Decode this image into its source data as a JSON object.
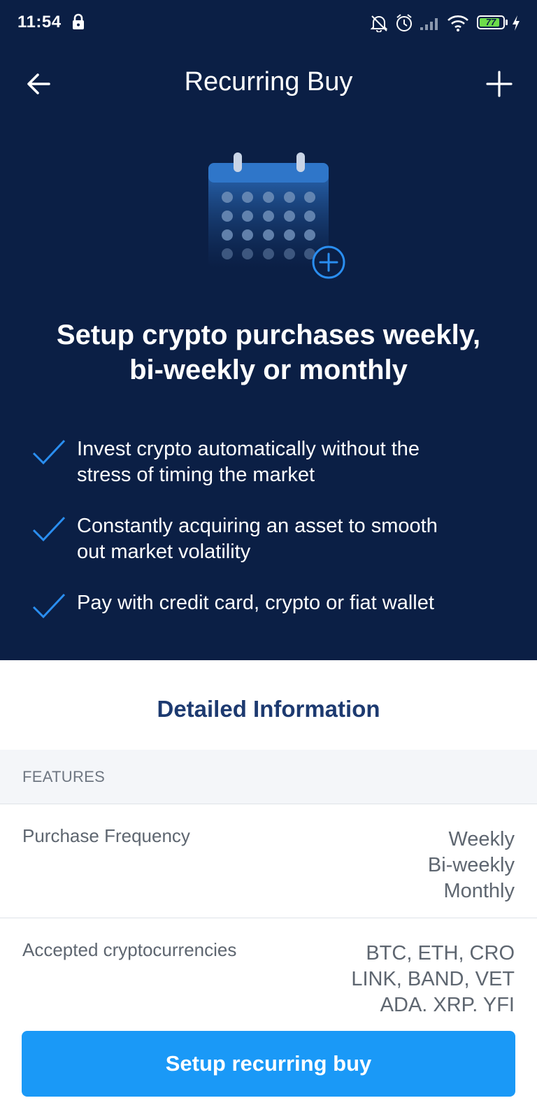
{
  "status_bar": {
    "time": "11:54",
    "battery_level": "77",
    "battery_fraction": 0.77,
    "icons": [
      "lock-icon",
      "mute-icon",
      "alarm-icon",
      "signal-icon",
      "wifi-icon",
      "battery-icon",
      "charging-icon"
    ]
  },
  "app_bar": {
    "title": "Recurring Buy",
    "back_icon": "arrow-left-icon",
    "add_icon": "plus-icon"
  },
  "hero": {
    "illustration": "calendar-plus-icon",
    "headline_line1": "Setup crypto purchases weekly,",
    "headline_line2": "bi-weekly or monthly",
    "benefits": [
      {
        "line1": "Invest crypto automatically without the",
        "line2": "stress of timing the market"
      },
      {
        "line1": "Constantly acquiring an asset to smooth",
        "line2": "out market volatility"
      },
      {
        "line1": "Pay with credit card, crypto or fiat wallet",
        "line2": ""
      }
    ]
  },
  "details": {
    "title": "Detailed Information",
    "section_label": "FEATURES",
    "rows": [
      {
        "label": "Purchase Frequency",
        "values": [
          "Weekly",
          "Bi-weekly",
          "Monthly"
        ]
      },
      {
        "label": "Accepted cryptocurrencies",
        "values": [
          "BTC, ETH, CRO",
          "LINK, BAND, VET",
          "ADA. XRP. YFI"
        ]
      }
    ]
  },
  "cta": {
    "label": "Setup recurring buy"
  },
  "colors": {
    "header_bg": "#0b1f45",
    "accent_blue": "#1a99f7",
    "title_blue": "#1d3a70",
    "check_blue": "#2a8ef0",
    "band_bg": "#f4f6f9"
  }
}
